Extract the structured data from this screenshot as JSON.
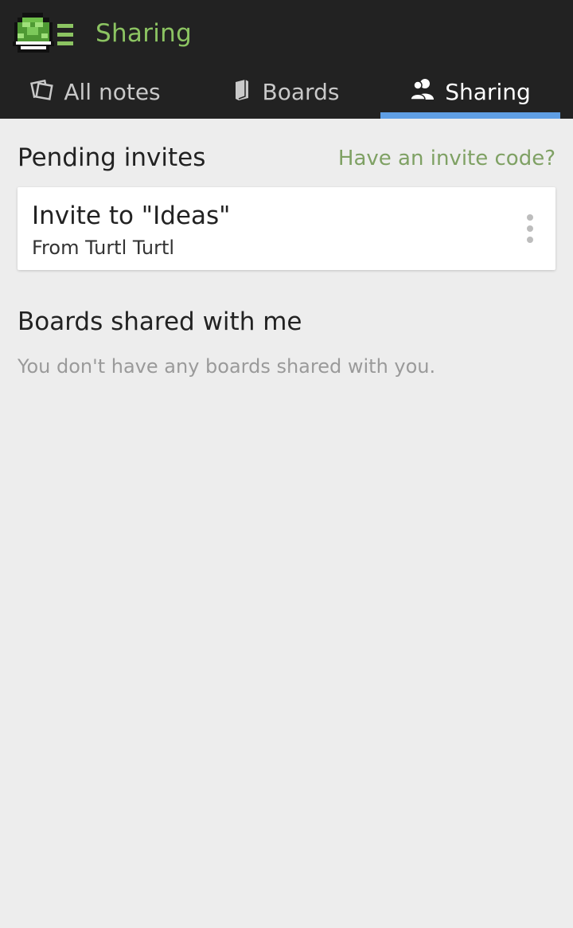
{
  "header": {
    "title": "Sharing"
  },
  "tabs": [
    {
      "label": "All notes",
      "icon": "notes-icon"
    },
    {
      "label": "Boards",
      "icon": "board-icon"
    },
    {
      "label": "Sharing",
      "icon": "people-icon",
      "active": true
    }
  ],
  "pending": {
    "title": "Pending invites",
    "invite_code_link": "Have an invite code?",
    "invites": [
      {
        "title": "Invite to \"Ideas\"",
        "from": "From Turtl Turtl"
      }
    ]
  },
  "shared": {
    "title": "Boards shared with me",
    "empty_message": "You don't have any boards shared with you."
  },
  "colors": {
    "appbar": "#222222",
    "brand_green": "#8cc462",
    "link_green": "#7fa164",
    "tab_indicator": "#5f9ee3",
    "background": "#ededed"
  }
}
